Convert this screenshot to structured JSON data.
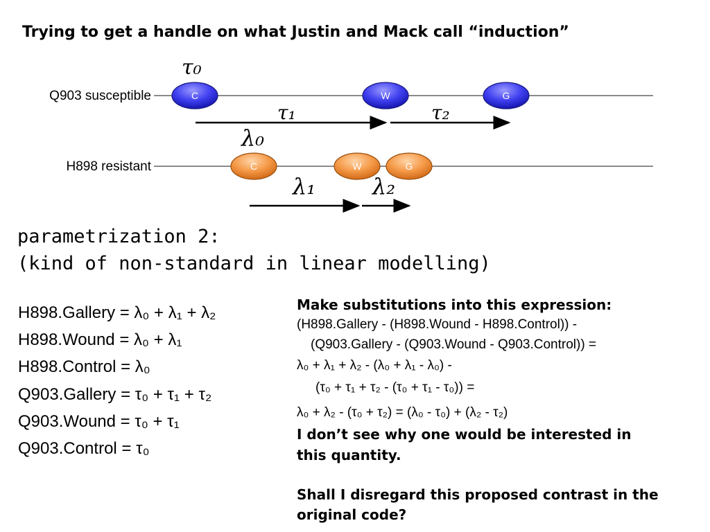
{
  "title": "Trying to get a handle on what Justin and Mack call “induction”",
  "timeline": {
    "q903_label": "Q903 susceptible",
    "h898_label": "H898 resistant",
    "nodes": {
      "c": "C",
      "w": "W",
      "g": "G"
    },
    "greek": {
      "tau0": "τ₀",
      "tau1": "τ₁",
      "tau2": "τ₂",
      "lambda0": "λ₀",
      "lambda1": "λ₁",
      "lambda2": "λ₂"
    },
    "colors": {
      "blue": "#3b3bf0",
      "orange": "#f29a4a"
    }
  },
  "param": {
    "line1": "parametrization 2:",
    "line2": "(kind of non-standard in linear modelling)"
  },
  "equations": [
    "H898.Gallery = λ₀ + λ₁ + λ₂",
    "H898.Wound = λ₀ + λ₁",
    "H898.Control = λ₀",
    "Q903.Gallery = τ₀ + τ₁ + τ₂",
    "Q903.Wound = τ₀ + τ₁",
    "Q903.Control = τ₀"
  ],
  "substitution": {
    "heading": "Make substitutions into this expression:",
    "lines": [
      "(H898.Gallery - (H898.Wound - H898.Control)) -",
      "(Q903.Gallery - (Q903.Wound - Q903.Control)) =",
      "λ₀ + λ₁ + λ₂ - (λ₀ + λ₁ - λ₀) -",
      "(τ₀ + τ₁ + τ₂ - (τ₀ + τ₁ - τ₀)) =",
      "λ₀ + λ₂ - (τ₀ + τ₂) = (λ₀ - τ₀) + (λ₂ - τ₂)"
    ],
    "comment1": "I don’t see why one would be interested in",
    "comment2": "this quantity.",
    "question1": "Shall I disregard this proposed contrast in the",
    "question2": "original code?"
  }
}
